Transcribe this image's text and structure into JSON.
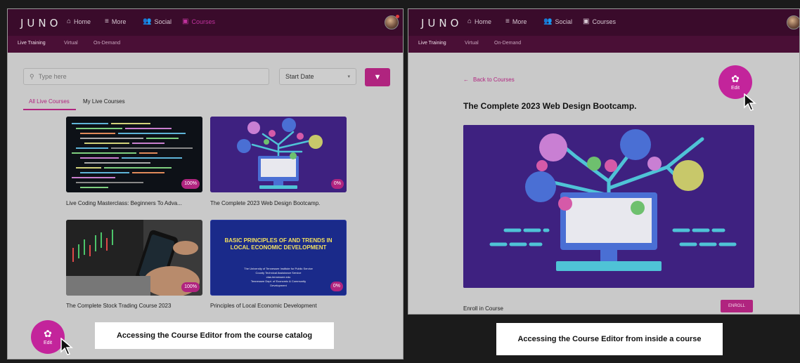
{
  "app": {
    "logo": "JUNO"
  },
  "nav": {
    "home": "Home",
    "more": "More",
    "social": "Social",
    "courses": "Courses"
  },
  "subnav": {
    "live": "Live Training",
    "virtual": "Virtual",
    "ondemand": "On-Demand"
  },
  "catalog": {
    "search_placeholder": "Type here",
    "sort_value": "Start Date",
    "tabs": [
      "All Live Courses",
      "My Live Courses"
    ],
    "cards": [
      {
        "title": "Live Coding Masterclass: Beginners To Adva...",
        "progress": "100%"
      },
      {
        "title": "The Complete 2023 Web Design Bootcamp.",
        "progress": "0%"
      },
      {
        "title": "The Complete Stock Trading Course 2023",
        "progress": "100%"
      },
      {
        "title": "Principles of Local Economic Development",
        "progress": "0%"
      }
    ],
    "econ_cover": {
      "heading": "BASIC PRINCIPLES OF AND TRENDS IN LOCAL ECONOMIC DEVELOPMENT",
      "line1": "The University of Tennessee Institute for Public Service",
      "line2": "County Technical Assistance Service",
      "line3": "ctas.tennessee.edu",
      "line4": "Tennessee Dept. of Economic & Community",
      "line5": "Development"
    }
  },
  "course": {
    "back": "Back to Courses",
    "title": "The Complete 2023 Web Design Bootcamp.",
    "enroll_label": "Enroll in Course",
    "enroll_button": "ENROLL"
  },
  "edit_label": "Edit",
  "captions": {
    "left": "Accessing the Course Editor from the course catalog",
    "right": "Accessing the Course Editor from inside a course"
  },
  "colors": {
    "brand": "#b0247f",
    "topbar": "#3a0b2b",
    "fab": "#c3249b"
  }
}
